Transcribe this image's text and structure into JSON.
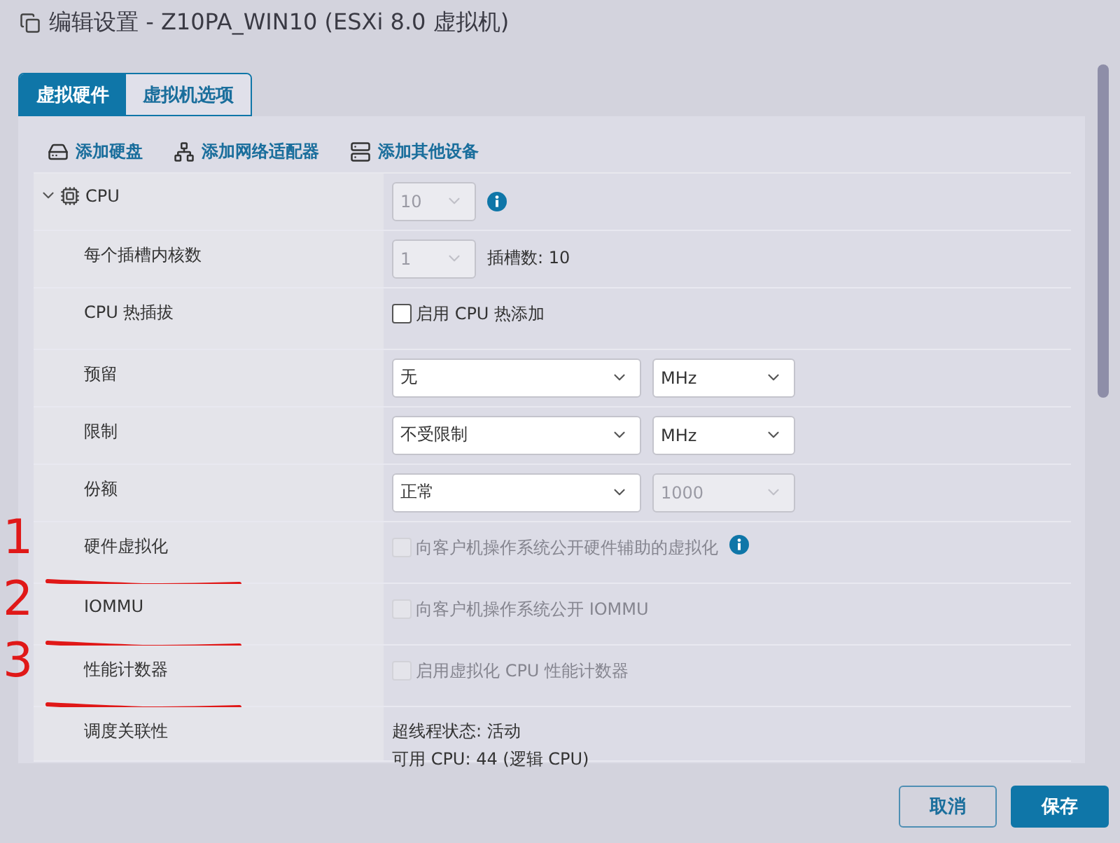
{
  "window": {
    "title": "编辑设置 - Z10PA_WIN10 (ESXi 8.0 虚拟机)"
  },
  "tabs": [
    {
      "label": "虚拟硬件",
      "selected": true
    },
    {
      "label": "虚拟机选项",
      "selected": false
    }
  ],
  "toolbar": [
    {
      "label": "添加硬盘",
      "kind": "disk"
    },
    {
      "label": "添加网络适配器",
      "kind": "network"
    },
    {
      "label": "添加其他设备",
      "kind": "device"
    }
  ],
  "rows": [
    {
      "label": "CPU",
      "kind": "select",
      "header": true,
      "expanded": true,
      "select": {
        "value": "10",
        "disabled": true
      },
      "info": true
    },
    {
      "label": "每个插槽内核数",
      "kind": "select",
      "select": {
        "value": "1",
        "disabled": true
      },
      "note": "插槽数: 10"
    },
    {
      "label": "CPU 热插拔",
      "kind": "checkbox",
      "checkbox": {
        "label": "启用 CPU 热添加",
        "checked": false,
        "disabled": false
      }
    },
    {
      "label": "预留",
      "kind": "dual",
      "select": {
        "value": "无",
        "disabled": false
      },
      "unit": {
        "value": "MHz",
        "disabled": false
      }
    },
    {
      "label": "限制",
      "kind": "dual",
      "select": {
        "value": "不受限制",
        "disabled": false
      },
      "unit": {
        "value": "MHz",
        "disabled": false
      }
    },
    {
      "label": "份额",
      "kind": "dual",
      "select": {
        "value": "正常",
        "disabled": false
      },
      "unit": {
        "value": "1000",
        "disabled": true
      }
    },
    {
      "label": "硬件虚拟化",
      "kind": "checkbox",
      "checkbox": {
        "label": "向客户机操作系统公开硬件辅助的虚拟化",
        "checked": false,
        "disabled": true
      },
      "info": true,
      "annotation": "1"
    },
    {
      "label": "IOMMU",
      "kind": "checkbox",
      "checkbox": {
        "label": "向客户机操作系统公开 IOMMU",
        "checked": false,
        "disabled": true
      },
      "annotation": "2"
    },
    {
      "label": "性能计数器",
      "kind": "checkbox",
      "checkbox": {
        "label": "启用虚拟化 CPU 性能计数器",
        "checked": false,
        "disabled": true
      },
      "annotation": "3"
    },
    {
      "label": "调度关联性",
      "kind": "text",
      "lines": [
        "超线程状态: 活动",
        "可用 CPU: 44 (逻辑 CPU)"
      ]
    }
  ],
  "buttons": [
    {
      "label": "取消",
      "kind": "secondary"
    },
    {
      "label": "保存",
      "kind": "primary"
    }
  ]
}
